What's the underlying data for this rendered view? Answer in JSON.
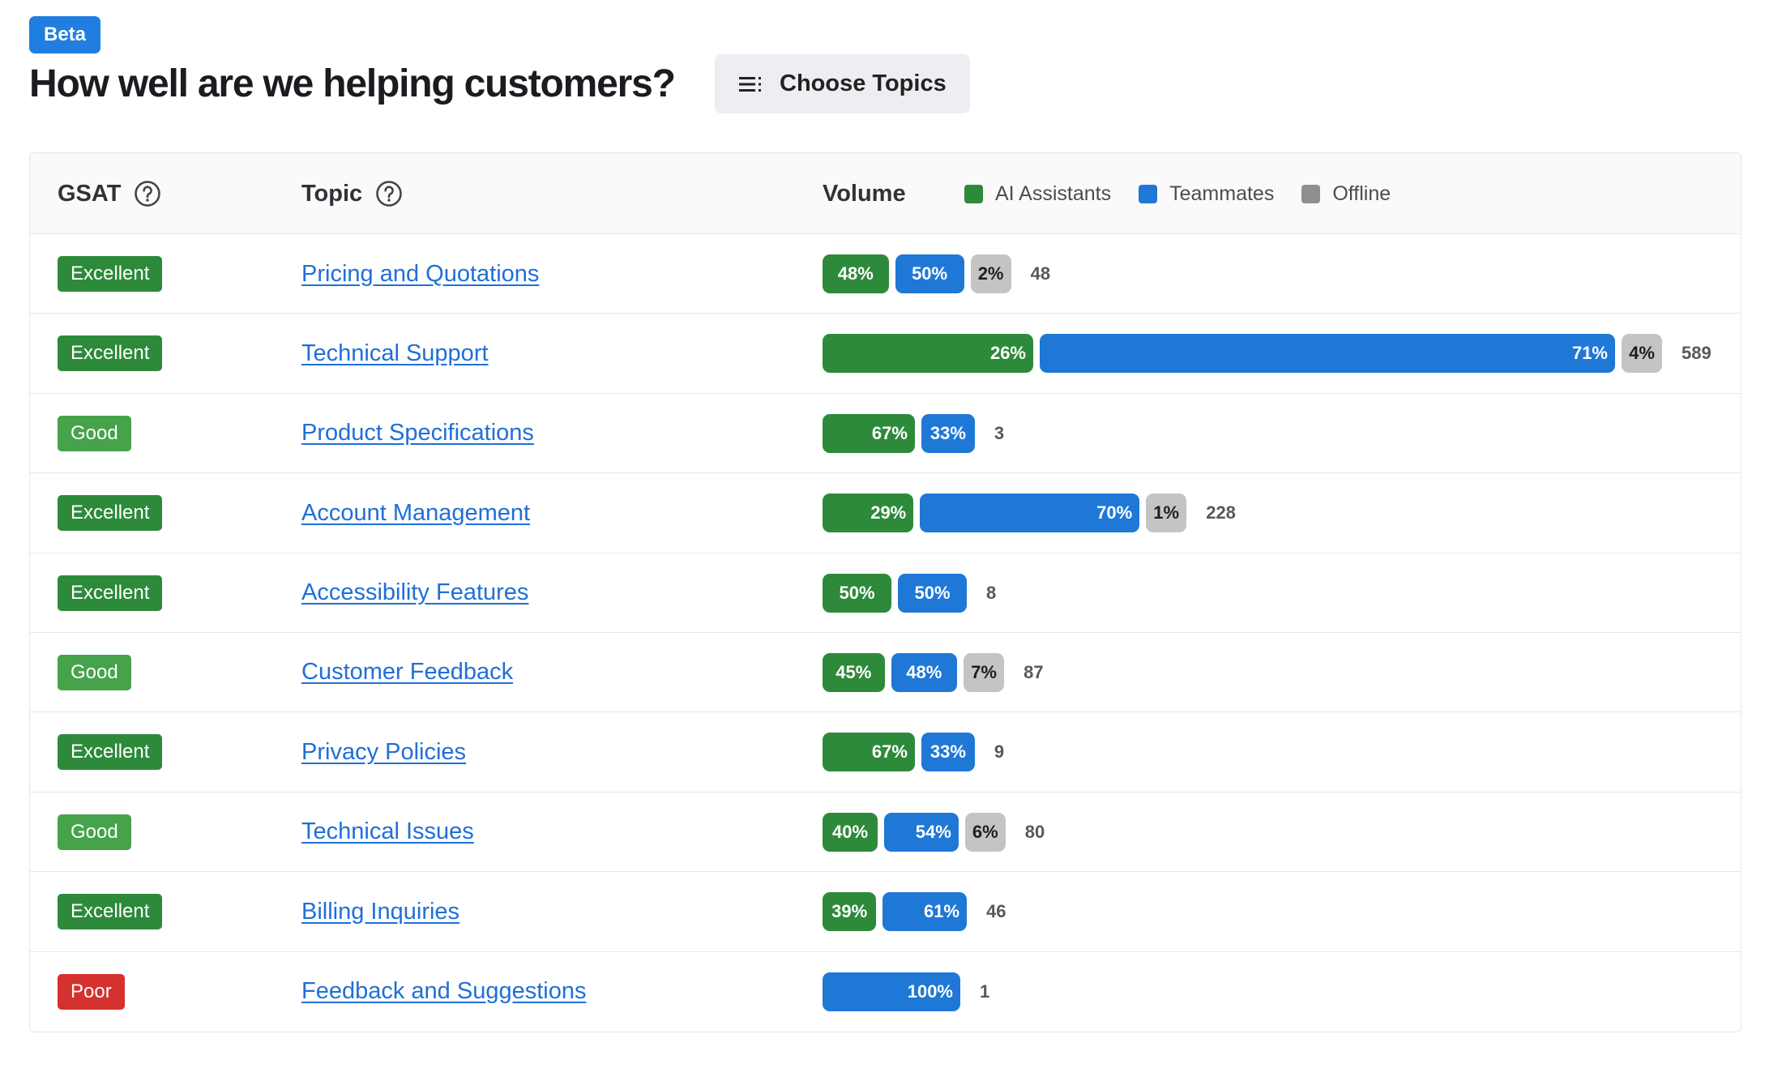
{
  "header": {
    "badge": "Beta",
    "title": "How well are we helping customers?",
    "choose_topics": "Choose Topics"
  },
  "table": {
    "columns": {
      "gsat": "GSAT",
      "topic": "Topic",
      "volume": "Volume"
    },
    "legend": [
      {
        "label": "AI Assistants",
        "color": "#2e8a3b"
      },
      {
        "label": "Teammates",
        "color": "#1f78d6"
      },
      {
        "label": "Offline",
        "color": "#8f8f8f"
      }
    ],
    "rows": [
      {
        "gsat": "Excellent",
        "topic": "Pricing and Quotations",
        "segments": [
          {
            "type": "ai",
            "label": "48%"
          },
          {
            "type": "tm",
            "label": "50%"
          },
          {
            "type": "off",
            "label": "2%"
          }
        ],
        "count": "48"
      },
      {
        "gsat": "Excellent",
        "topic": "Technical Support",
        "segments": [
          {
            "type": "ai",
            "label": "26%"
          },
          {
            "type": "tm",
            "label": "71%"
          },
          {
            "type": "off",
            "label": "4%"
          }
        ],
        "count": "589"
      },
      {
        "gsat": "Good",
        "topic": "Product Specifications",
        "segments": [
          {
            "type": "ai",
            "label": "67%"
          },
          {
            "type": "tm",
            "label": "33%"
          }
        ],
        "count": "3"
      },
      {
        "gsat": "Excellent",
        "topic": "Account Management",
        "segments": [
          {
            "type": "ai",
            "label": "29%"
          },
          {
            "type": "tm",
            "label": "70%"
          },
          {
            "type": "off",
            "label": "1%"
          }
        ],
        "count": "228"
      },
      {
        "gsat": "Excellent",
        "topic": "Accessibility Features",
        "segments": [
          {
            "type": "ai",
            "label": "50%"
          },
          {
            "type": "tm",
            "label": "50%"
          }
        ],
        "count": "8"
      },
      {
        "gsat": "Good",
        "topic": "Customer Feedback",
        "segments": [
          {
            "type": "ai",
            "label": "45%"
          },
          {
            "type": "tm",
            "label": "48%"
          },
          {
            "type": "off",
            "label": "7%"
          }
        ],
        "count": "87"
      },
      {
        "gsat": "Excellent",
        "topic": "Privacy Policies",
        "segments": [
          {
            "type": "ai",
            "label": "67%"
          },
          {
            "type": "tm",
            "label": "33%"
          }
        ],
        "count": "9"
      },
      {
        "gsat": "Good",
        "topic": "Technical Issues",
        "segments": [
          {
            "type": "ai",
            "label": "40%"
          },
          {
            "type": "tm",
            "label": "54%"
          },
          {
            "type": "off",
            "label": "6%"
          }
        ],
        "count": "80"
      },
      {
        "gsat": "Excellent",
        "topic": "Billing Inquiries",
        "segments": [
          {
            "type": "ai",
            "label": "39%"
          },
          {
            "type": "tm",
            "label": "61%"
          }
        ],
        "count": "46"
      },
      {
        "gsat": "Poor",
        "topic": "Feedback and Suggestions",
        "segments": [
          {
            "type": "tm",
            "label": "100%"
          }
        ],
        "count": "1"
      }
    ]
  }
}
